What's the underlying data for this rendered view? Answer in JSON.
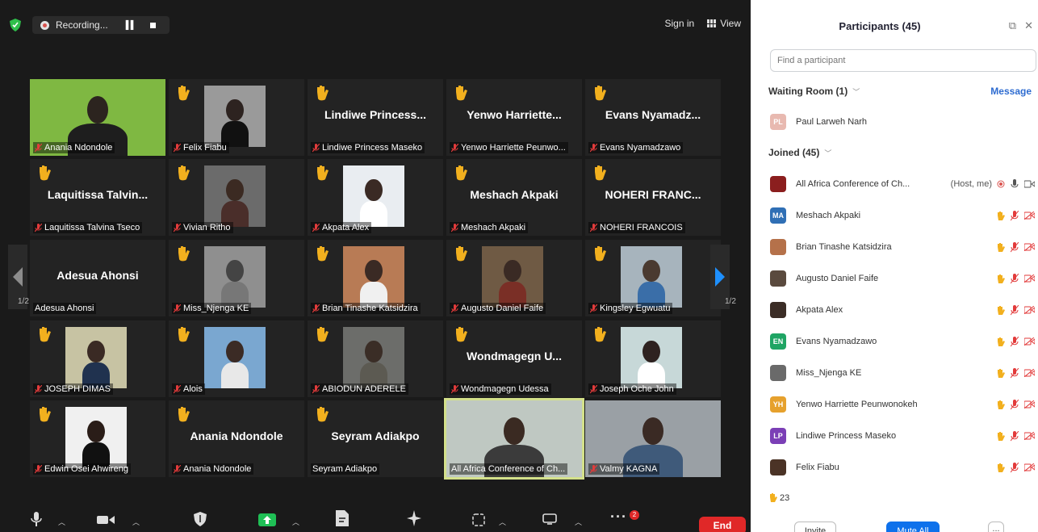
{
  "meeting": {
    "recording_label": "Recording...",
    "sign_in": "Sign in",
    "view": "View",
    "page_left": "1/2",
    "page_right": "1/2",
    "end_label": "End",
    "toolbar_badge": "2"
  },
  "tiles": [
    {
      "name": "Anania Ndondole",
      "center_name": "",
      "muted": true,
      "hand": false,
      "video": true
    },
    {
      "name": "Felix Fiabu",
      "center_name": "",
      "muted": true,
      "hand": true,
      "video": true
    },
    {
      "name": "Lindiwe Princess Maseko",
      "center_name": "Lindiwe Princess...",
      "muted": true,
      "hand": true,
      "video": false
    },
    {
      "name": "Yenwo Harriette Peunwo...",
      "center_name": "Yenwo Harriette...",
      "muted": true,
      "hand": true,
      "video": false
    },
    {
      "name": "Evans Nyamadzawo",
      "center_name": "Evans Nyamadz...",
      "muted": true,
      "hand": true,
      "video": false
    },
    {
      "name": "Laquitissa Talvina Tseco",
      "center_name": "Laquitissa Talvin...",
      "muted": true,
      "hand": true,
      "video": false
    },
    {
      "name": "Vivian Ritho",
      "center_name": "",
      "muted": true,
      "hand": true,
      "video": true
    },
    {
      "name": "Akpata Alex",
      "center_name": "",
      "muted": true,
      "hand": true,
      "video": true
    },
    {
      "name": "Meshach Akpaki",
      "center_name": "Meshach Akpaki",
      "muted": true,
      "hand": true,
      "video": false
    },
    {
      "name": "NOHERI FRANCOIS",
      "center_name": "NOHERI FRANC...",
      "muted": true,
      "hand": true,
      "video": false
    },
    {
      "name": "Adesua Ahonsi",
      "center_name": "Adesua Ahonsi",
      "muted": false,
      "hand": false,
      "video": false
    },
    {
      "name": "Miss_Njenga KE",
      "center_name": "",
      "muted": true,
      "hand": true,
      "video": true
    },
    {
      "name": "Brian Tinashe Katsidzira",
      "center_name": "",
      "muted": true,
      "hand": true,
      "video": true
    },
    {
      "name": "Augusto Daniel Faife",
      "center_name": "",
      "muted": true,
      "hand": true,
      "video": true
    },
    {
      "name": "Kingsley Egwuatu",
      "center_name": "",
      "muted": true,
      "hand": true,
      "video": true
    },
    {
      "name": "JOSEPH DIMAS",
      "center_name": "",
      "muted": true,
      "hand": true,
      "video": true
    },
    {
      "name": "Alois",
      "center_name": "",
      "muted": true,
      "hand": true,
      "video": true
    },
    {
      "name": "ABIODUN ADERELE",
      "center_name": "",
      "muted": true,
      "hand": true,
      "video": true
    },
    {
      "name": "Wondmagegn Udessa",
      "center_name": "Wondmagegn U...",
      "muted": true,
      "hand": true,
      "video": false
    },
    {
      "name": "Joseph Oche John",
      "center_name": "",
      "muted": true,
      "hand": true,
      "video": true
    },
    {
      "name": "Edwin Osei Ahwireng",
      "center_name": "",
      "muted": true,
      "hand": true,
      "video": true
    },
    {
      "name": "Anania Ndondole",
      "center_name": "Anania Ndondole",
      "muted": true,
      "hand": true,
      "video": false
    },
    {
      "name": "Seyram Adiakpo",
      "center_name": "Seyram Adiakpo",
      "muted": false,
      "hand": true,
      "video": false
    },
    {
      "name": "All Africa Conference of Ch...",
      "center_name": "",
      "muted": false,
      "hand": false,
      "video": true
    },
    {
      "name": "Valmy  KAGNA",
      "center_name": "",
      "muted": true,
      "hand": false,
      "video": true
    }
  ],
  "panel": {
    "title": "Participants (45)",
    "search_placeholder": "Find a participant",
    "waiting_room": "Waiting Room (1)",
    "message": "Message",
    "waiting": [
      {
        "initials": "PL",
        "name": "Paul Larweh Narh",
        "color": "#e8b9b0"
      }
    ],
    "joined_header": "Joined (45)",
    "joined": [
      {
        "initials": "",
        "name": "All Africa Conference of Ch...",
        "role": "(Host, me)",
        "color": "#8b1e1e",
        "icons": "host"
      },
      {
        "initials": "MA",
        "name": "Meshach Akpaki",
        "role": "",
        "color": "#2f6fb5",
        "icons": "hand"
      },
      {
        "initials": "",
        "name": "Brian Tinashe Katsidzira",
        "role": "",
        "color": "#b5714a",
        "icons": "hand"
      },
      {
        "initials": "",
        "name": "Augusto Daniel Faife",
        "role": "",
        "color": "#5a4a3e",
        "icons": "hand"
      },
      {
        "initials": "",
        "name": "Akpata Alex",
        "role": "",
        "color": "#3b2d26",
        "icons": "hand"
      },
      {
        "initials": "EN",
        "name": "Evans Nyamadzawo",
        "role": "",
        "color": "#1fa564",
        "icons": "hand"
      },
      {
        "initials": "",
        "name": "Miss_Njenga KE",
        "role": "",
        "color": "#6a6a6a",
        "icons": "hand"
      },
      {
        "initials": "YH",
        "name": "Yenwo Harriette Peunwonokeh",
        "role": "",
        "color": "#e6a12d",
        "icons": "hand"
      },
      {
        "initials": "LP",
        "name": "Lindiwe Princess Maseko",
        "role": "",
        "color": "#7b3fb6",
        "icons": "hand"
      },
      {
        "initials": "",
        "name": "Felix Fiabu",
        "role": "",
        "color": "#4b3326",
        "icons": "hand"
      }
    ],
    "hands_count": "23",
    "invite": "Invite",
    "mute_all": "Mute All",
    "more": "..."
  },
  "colors": {
    "meeting_bg": "#1a1a1a",
    "tile_bg": "#232323",
    "hand": "#f2b01e",
    "mute_red": "#e23b3b",
    "active_border": "#d3e08a",
    "end_red": "#e02828",
    "accent_blue": "#0e71eb"
  }
}
